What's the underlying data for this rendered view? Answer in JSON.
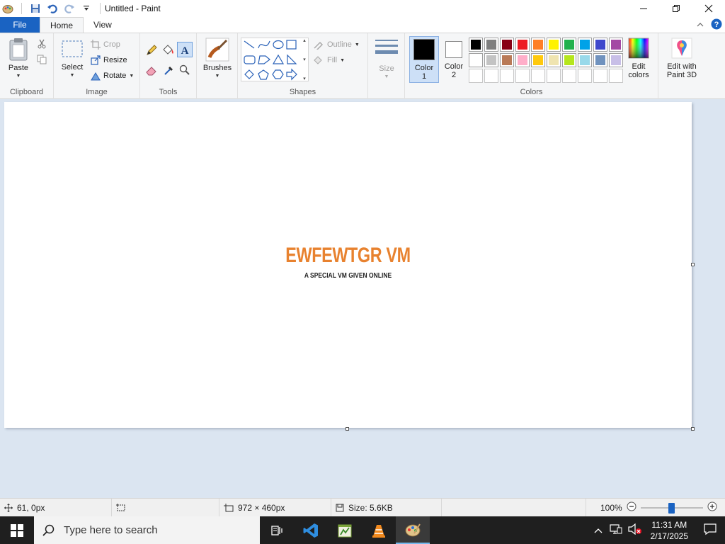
{
  "window": {
    "title": "Untitled - Paint",
    "minimize_glyph": "—",
    "close_glyph": "✕"
  },
  "tabs": {
    "file": "File",
    "home": "Home",
    "view": "View"
  },
  "ribbon": {
    "clipboard": {
      "paste": "Paste",
      "group": "Clipboard"
    },
    "image": {
      "select": "Select",
      "crop": "Crop",
      "resize": "Resize",
      "rotate": "Rotate",
      "group": "Image"
    },
    "tools": {
      "group": "Tools"
    },
    "brushes": {
      "label": "Brushes"
    },
    "shapes": {
      "outline": "Outline",
      "fill": "Fill",
      "group": "Shapes"
    },
    "size": {
      "label": "Size"
    },
    "colors": {
      "color1": "Color",
      "color1_num": "1",
      "color2": "Color",
      "color2_num": "2",
      "edit_colors_1": "Edit",
      "edit_colors_2": "colors",
      "paint3d_1": "Edit with",
      "paint3d_2": "Paint 3D",
      "group": "Colors",
      "palette_row1": [
        "#000000",
        "#7f7f7f",
        "#880015",
        "#ed1c24",
        "#ff7f27",
        "#fff200",
        "#22b14c",
        "#00a2e8",
        "#3f48cc",
        "#a349a4"
      ],
      "palette_row2": [
        "#ffffff",
        "#c3c3c3",
        "#b97a57",
        "#ffaec9",
        "#ffc90e",
        "#efe4b0",
        "#b5e61d",
        "#99d9ea",
        "#7092be",
        "#c8bfe7"
      ],
      "color1_value": "#000000",
      "color2_value": "#ffffff"
    }
  },
  "canvas": {
    "title": "EWFEWTGR VM",
    "subtitle": "A SPECIAL VM GIVEN ONLINE",
    "title_color": "#e8822f"
  },
  "statusbar": {
    "cursor_pos": "61, 0px",
    "dimensions": "972 × 460px",
    "size": "Size: 5.6KB",
    "zoom": "100%",
    "zoom_level": 0.5
  },
  "taskbar": {
    "search_placeholder": "Type here to search",
    "time": "11:31 AM",
    "date": "2/17/2025"
  }
}
